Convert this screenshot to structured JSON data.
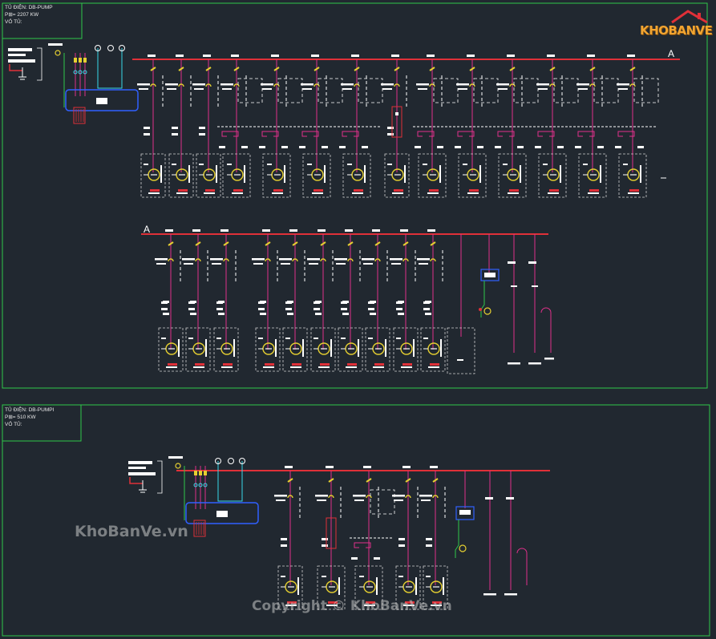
{
  "panel_top": {
    "line1": "TỦ ĐIỆN: DB-PUMP",
    "line2": "P⊞= 2207 KW",
    "line3": "VỎ TỦ:",
    "bus_label_right": "A",
    "bus_label_left": "A"
  },
  "panel_bottom": {
    "line1": "TỦ ĐIỆN: DB-PUMPI",
    "line2": "P⊞= 510 KW",
    "line3": "VỎ TỦ:"
  },
  "branding": {
    "logo_text": "KHOBANVE",
    "watermark_main": "KhoBanVe.vn",
    "watermark_copyright": "Copyright © KhoBanVe.vn"
  },
  "colors": {
    "background": "#212830",
    "frame_green": "#2ec74a",
    "busbar_red": "#e03038",
    "wire_magenta": "#e0308a",
    "switch_yellow": "#e6d030",
    "control_cyan": "#38d8e8",
    "control_blue": "#3060ff",
    "symbol_white": "#ffffff",
    "dashed_box": "#cfcfcf",
    "logo_orange": "#f2a531"
  }
}
